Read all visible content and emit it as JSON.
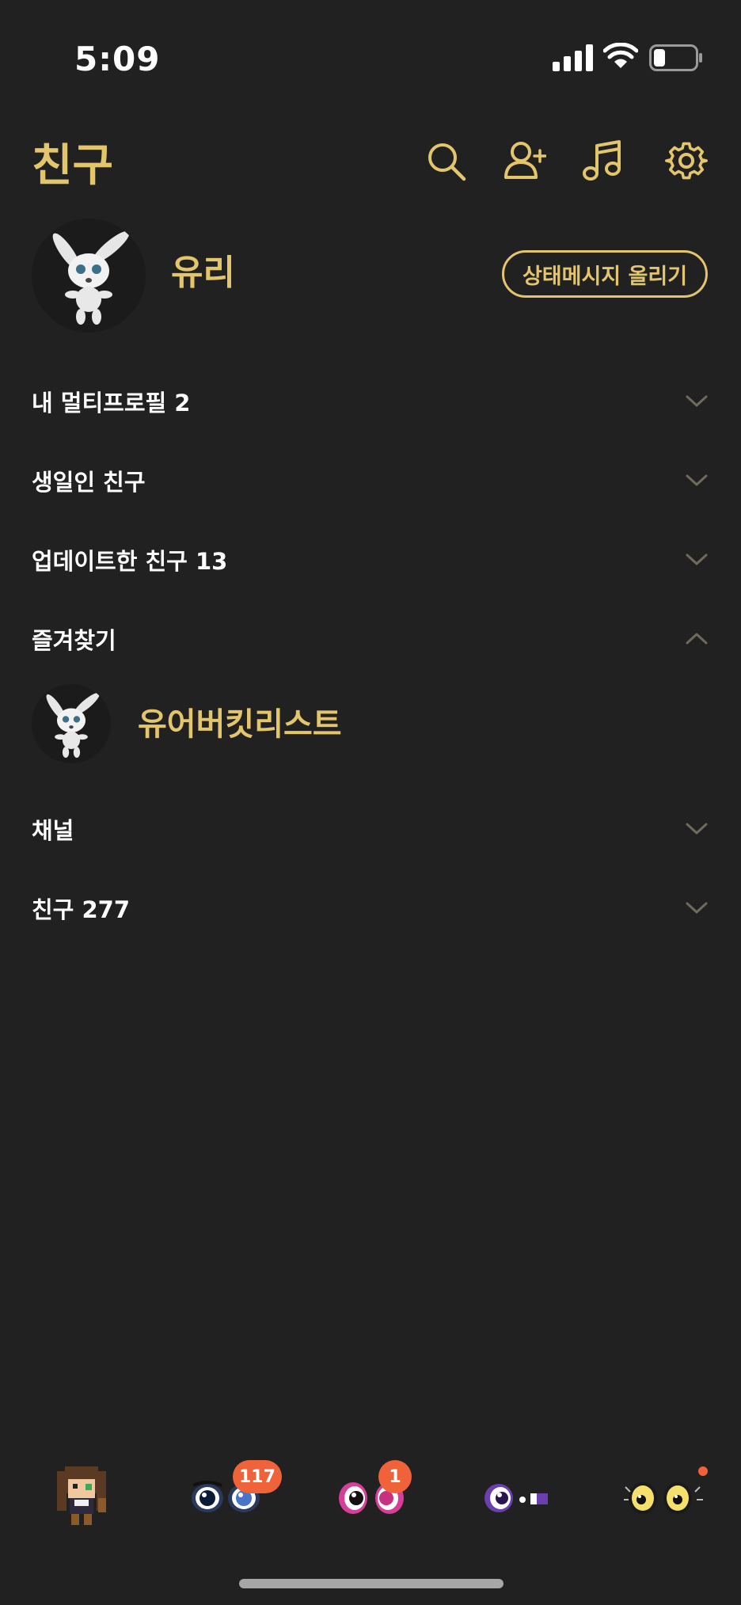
{
  "status_bar": {
    "time": "5:09"
  },
  "header": {
    "title": "친구",
    "icons": [
      "search-icon",
      "add-friend-icon",
      "music-icon",
      "settings-icon"
    ]
  },
  "profile": {
    "name": "유리",
    "status_button_label": "상태메시지 올리기"
  },
  "sections": [
    {
      "label": "내 멀티프로필 2",
      "expanded": false
    },
    {
      "label": "생일인 친구",
      "expanded": false
    },
    {
      "label": "업데이트한 친구 13",
      "expanded": false
    },
    {
      "label": "즐겨찾기",
      "expanded": true
    },
    {
      "label": "채널",
      "expanded": false
    },
    {
      "label": "친구 277",
      "expanded": false
    }
  ],
  "favorites": [
    {
      "name": "유어버킷리스트"
    }
  ],
  "tab_bar": {
    "tabs": [
      {
        "name": "friends",
        "badge": ""
      },
      {
        "name": "chats",
        "badge": "117"
      },
      {
        "name": "openchat",
        "badge": "1"
      },
      {
        "name": "shopping",
        "badge": ""
      },
      {
        "name": "more",
        "badge": ""
      }
    ]
  },
  "colors": {
    "background": "#212121",
    "accent": "#e3c56c",
    "badge": "#f0633a",
    "text": "#ffffff"
  }
}
